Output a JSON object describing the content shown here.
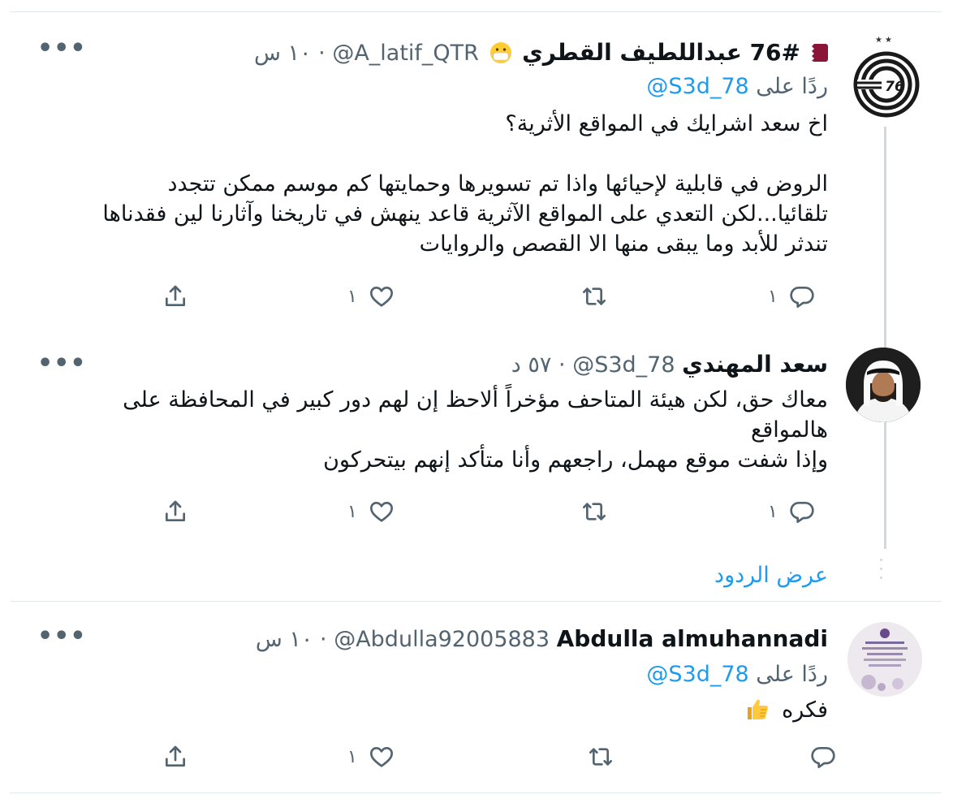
{
  "tweets": [
    {
      "display_name": "76# عبداللطيف القطري",
      "handle": "@A_latif_QTR",
      "time": "١٠ س",
      "replying_prefix": "ردًا على",
      "replying_mention": "@S3d_78",
      "body_lines": [
        "اخ سعد اشرايك في المواقع الأثرية؟",
        "",
        "الروض في قابلية لإحيائها واذا تم تسويرها وحمايتها كم موسم ممكن تتجدد",
        "تلقائيا...لكن التعدي على المواقع الآثرية قاعد ينهش في تاريخنا وآثارنا لين فقدناها",
        "تندثر للأبد وما يبقى منها الا القصص والروايات"
      ],
      "reply_count": "١",
      "retweet_count": "",
      "like_count": "١"
    },
    {
      "display_name": "سعد المهندي",
      "handle": "@S3d_78",
      "time": "٥٧ د",
      "body_lines": [
        "معاك حق، لكن هيئة المتاحف مؤخراً ألاحظ إن لهم دور كبير في المحافظة على",
        "هالمواقع",
        "وإذا شفت موقع مهمل، راجعهم وأنا متأكد إنهم بيتحركون"
      ],
      "reply_count": "١",
      "retweet_count": "",
      "like_count": "١"
    },
    {
      "display_name": "Abdulla almuhannadi",
      "handle": "@Abdulla92005883",
      "time": "١٠ س",
      "replying_prefix": "ردًا على",
      "replying_mention": "@S3d_78",
      "body_text": "فكره",
      "reply_count": "",
      "retweet_count": "",
      "like_count": "١"
    }
  ],
  "separator_dot": "·",
  "more_glyph": "•••",
  "show_replies": "عرض الردود",
  "icons": {
    "reply": "reply-icon",
    "retweet": "retweet-icon",
    "like": "heart-icon",
    "share": "share-icon",
    "more": "more-icon"
  },
  "colors": {
    "link": "#1d9bf0",
    "secondary_text": "#536471",
    "primary_text": "#0f1419",
    "thread_line": "#cfd9de",
    "flag_maroon": "#8a1538"
  }
}
